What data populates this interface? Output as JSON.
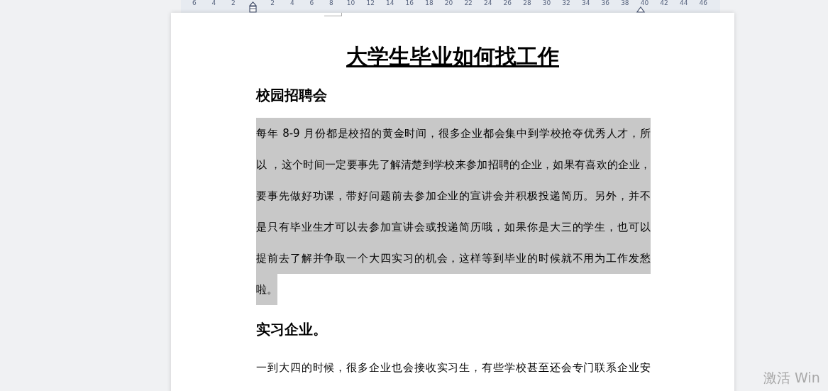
{
  "ruler": {
    "left_numbers": [
      "6",
      "4",
      "2"
    ],
    "right_numbers": [
      "2",
      "4",
      "6",
      "8",
      "10",
      "12",
      "14",
      "16",
      "18",
      "20",
      "22",
      "24",
      "26",
      "28",
      "30",
      "32",
      "34",
      "36",
      "38",
      "40",
      "42",
      "44",
      "46"
    ]
  },
  "document": {
    "title": "大学生毕业如何找工作",
    "blocks": [
      {
        "kind": "heading",
        "text": "校园招聘会"
      },
      {
        "kind": "paragraph",
        "selected": true,
        "lines": [
          "每年 8-9 月份都是校招的黄金时间，很多企业都会集中到学校抢夺优秀人才，所",
          "以 ，这个时间一定要事先了解清楚到学校来参加招聘的企业，如果有喜欢的企业，",
          "要事先做好功课，带好问题前去参加企业的宣讲会并积极投递简历。另外，并不",
          "是只有毕业生才可以去参加宣讲会或投递简历哦，如果你是大三的学生，也可以",
          "提前去了解并争取一个大四实习的机会，这样等到毕业的时候就不用为工作发愁",
          "啦。"
        ]
      },
      {
        "kind": "heading",
        "text": "实习企业。"
      },
      {
        "kind": "paragraph",
        "selected": false,
        "lines": [
          "一到大四的时候，很多企业也会接收实习生，有些学校甚至还会专门联系企业安"
        ]
      }
    ]
  },
  "activation_notice": "激活 Win"
}
